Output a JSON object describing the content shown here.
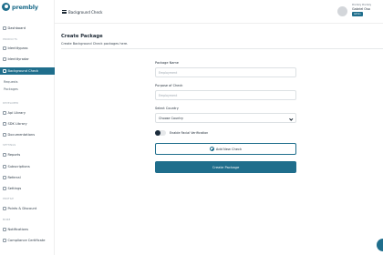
{
  "brand": {
    "name": "prembly",
    "color": "#1f6e8c"
  },
  "sidebar": {
    "dashboard": "Dashboard",
    "sections": {
      "products": "PRODUCTS",
      "developer": "DEVELOPER",
      "settings": "SETTINGS",
      "profile": "PROFILE",
      "more": "MORE"
    },
    "items": [
      {
        "label": "Identitypass",
        "icon": "shield-icon"
      },
      {
        "label": "Identityradar",
        "icon": "radar-icon"
      },
      {
        "label": "Background Check",
        "icon": "check-icon",
        "active": true
      },
      {
        "label": "Api Library",
        "icon": "code-icon"
      },
      {
        "label": "SDK Library",
        "icon": "package-icon"
      },
      {
        "label": "Documentations",
        "icon": "document-icon"
      },
      {
        "label": "Reports",
        "icon": "chart-icon"
      },
      {
        "label": "Subscriptions",
        "icon": "card-icon"
      },
      {
        "label": "Referral",
        "icon": "users-icon"
      },
      {
        "label": "Settings",
        "icon": "gear-icon"
      },
      {
        "label": "Points & Discount",
        "icon": "tag-icon"
      },
      {
        "label": "Notifications",
        "icon": "bell-icon"
      },
      {
        "label": "Compliance Certificate",
        "icon": "certificate-icon"
      }
    ],
    "sub_items": [
      "Requests",
      "Packages"
    ]
  },
  "topbar": {
    "title": "Background Check",
    "user": {
      "company": "Prembly Prembly",
      "name": "Gabriel Oso",
      "role": "Admin"
    }
  },
  "main": {
    "title": "Create Package",
    "subtitle": "Create Background Check packages here.",
    "fields": {
      "package_name": {
        "label": "Package Name",
        "placeholder": "Employment"
      },
      "purpose": {
        "label": "Purpose of Check",
        "placeholder": "Employment"
      },
      "country": {
        "label": "Select Country",
        "value": "Choose Country"
      }
    },
    "toggle": {
      "label": "Enable Facial Verification",
      "enabled": false
    },
    "add_check_label": "Add New Check",
    "create_label": "Create Package"
  }
}
